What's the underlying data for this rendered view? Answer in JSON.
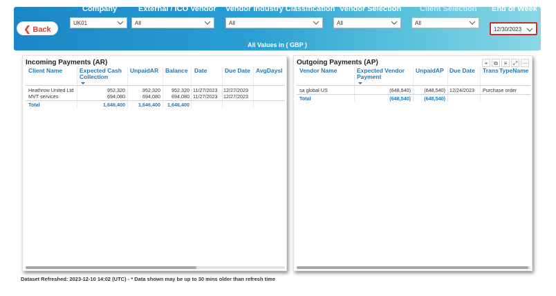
{
  "back_button": {
    "label": "Back"
  },
  "filters": [
    {
      "label": "Company",
      "value": "UK01"
    },
    {
      "label": "External / ICO Vendor",
      "value": "All"
    },
    {
      "label": "Vendor Industry Classification",
      "value": "All"
    },
    {
      "label": "Vendor Selection",
      "value": "All"
    },
    {
      "label": "Client Selection",
      "value": "All"
    },
    {
      "label": "End of Week",
      "value": "12/30/2023"
    }
  ],
  "values_note": "All Values in ( GBP )",
  "incoming": {
    "title": "Incoming Payments (AR)",
    "columns": [
      "Client Name",
      "Expected Cash Collection",
      "UnpaidAR",
      "Balance",
      "Date",
      "Due Date",
      "AvgDaysl"
    ],
    "rows": [
      [
        "Heathrow United Ltd",
        "952,320",
        "952,320",
        "952,320",
        "11/27/2023",
        "12/27/2023",
        ""
      ],
      [
        "MVT services",
        "694,080",
        "694,080",
        "694,080",
        "11/27/2023",
        "12/27/2023",
        ""
      ]
    ],
    "total": [
      "Total",
      "1,646,400",
      "1,646,400",
      "1,646,400",
      "",
      "",
      ""
    ]
  },
  "outgoing": {
    "title": "Outgoing Payments (AP)",
    "columns": [
      "Vendor Name",
      "Expected Vendor Payment",
      "UnpaidAP",
      "Due Date",
      "Trans",
      "TypeName"
    ],
    "rows": [
      [
        "sa global US",
        "(648,540)",
        "(648,540)",
        "12/24/2023",
        "",
        "Purchase order"
      ]
    ],
    "total": [
      "Total",
      "(648,540)",
      "(648,540)",
      "",
      "",
      ""
    ],
    "toolbar_icons": [
      "pin-icon",
      "copy-icon",
      "filter-icon",
      "focus-mode-icon",
      "more-options-icon"
    ]
  },
  "footer": "Dataset Refreshed: 2023-12-10 14:02 (UTC) - * Data shown may be up to 30 mins older than refresh time",
  "colors": {
    "header_start": "#1b86c6",
    "header_end": "#8ad7e6",
    "accent": "#1f77b4",
    "back_text": "#d9432f",
    "highlight": "#c0302c"
  }
}
